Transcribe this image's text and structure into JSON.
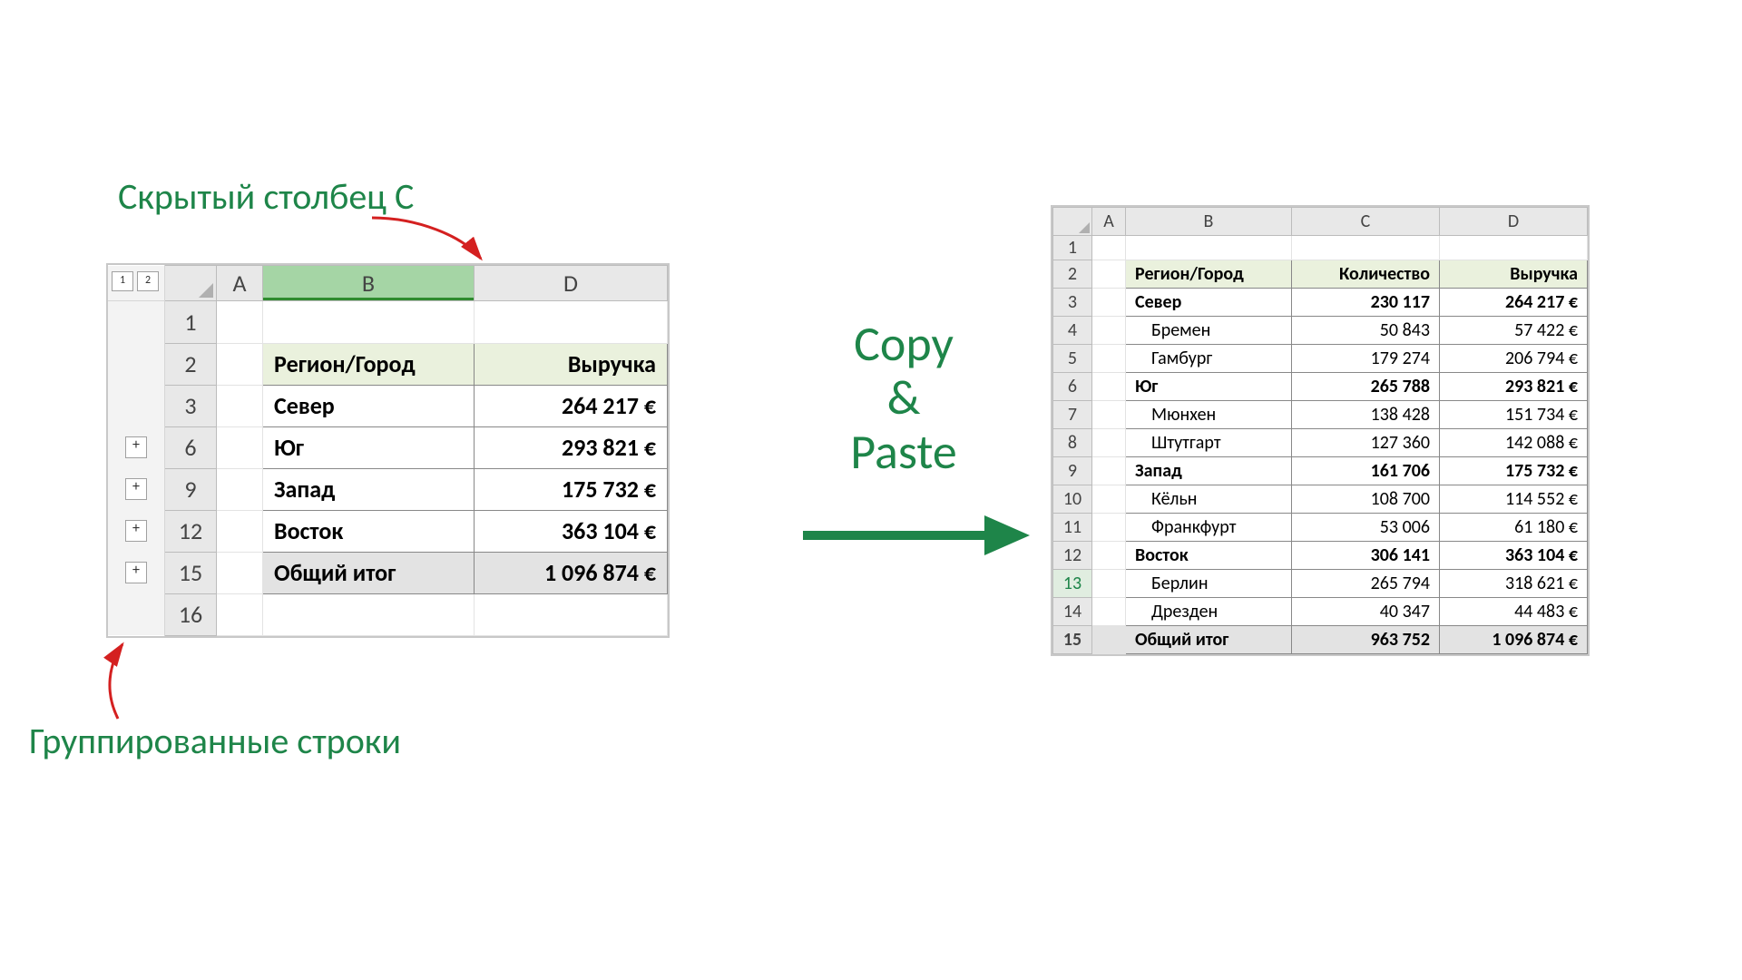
{
  "annotations": {
    "hidden_column": "Скрытый столбец C",
    "grouped_rows": "Группированные строки",
    "copy_paste_line1": "Copy",
    "copy_paste_line2": "&",
    "copy_paste_line3": "Paste"
  },
  "source": {
    "outline_levels": [
      "1",
      "2"
    ],
    "col_headers": {
      "A": "A",
      "B": "B",
      "D": "D"
    },
    "rows": [
      {
        "num": "1",
        "plus": false
      },
      {
        "num": "2",
        "plus": false,
        "header": true,
        "b": "Регион/Город",
        "d": "Выручка"
      },
      {
        "num": "3",
        "plus": false,
        "b": "Север",
        "d": "264 217 €",
        "bold": true
      },
      {
        "num": "6",
        "plus": true,
        "b": "Юг",
        "d": "293 821 €",
        "bold": true
      },
      {
        "num": "9",
        "plus": true,
        "b": "Запад",
        "d": "175 732 €",
        "bold": true
      },
      {
        "num": "12",
        "plus": true,
        "b": "Восток",
        "d": "363 104 €",
        "bold": true
      },
      {
        "num": "15",
        "plus": true,
        "total": true,
        "b": "Общий итог",
        "d": "1 096 874 €"
      },
      {
        "num": "16",
        "plus": false
      }
    ]
  },
  "dest": {
    "col_headers": {
      "A": "A",
      "B": "B",
      "C": "C",
      "D": "D"
    },
    "header": {
      "b": "Регион/Город",
      "c": "Количество",
      "d": "Выручка"
    },
    "rows": [
      {
        "n": "1"
      },
      {
        "n": "2",
        "header": true
      },
      {
        "n": "3",
        "b": "Север",
        "c": "230 117",
        "d": "264 217 €",
        "bold": true
      },
      {
        "n": "4",
        "b": "Бремен",
        "c": "50 843",
        "d": "57 422 €",
        "indent": true
      },
      {
        "n": "5",
        "b": "Гамбург",
        "c": "179 274",
        "d": "206 794 €",
        "indent": true
      },
      {
        "n": "6",
        "b": "Юг",
        "c": "265 788",
        "d": "293 821 €",
        "bold": true
      },
      {
        "n": "7",
        "b": "Мюнхен",
        "c": "138 428",
        "d": "151 734 €",
        "indent": true
      },
      {
        "n": "8",
        "b": "Штутгарт",
        "c": "127 360",
        "d": "142 088 €",
        "indent": true
      },
      {
        "n": "9",
        "b": "Запад",
        "c": "161 706",
        "d": "175 732 €",
        "bold": true
      },
      {
        "n": "10",
        "b": "Кёльн",
        "c": "108 700",
        "d": "114 552 €",
        "indent": true
      },
      {
        "n": "11",
        "b": "Франкфурт",
        "c": "53 006",
        "d": "61 180 €",
        "indent": true
      },
      {
        "n": "12",
        "b": "Восток",
        "c": "306 141",
        "d": "363 104 €",
        "bold": true
      },
      {
        "n": "13",
        "b": "Берлин",
        "c": "265 794",
        "d": "318 621 €",
        "indent": true,
        "sel": true
      },
      {
        "n": "14",
        "b": "Дрезден",
        "c": "40 347",
        "d": "44 483 €",
        "indent": true
      },
      {
        "n": "15",
        "b": "Общий итог",
        "c": "963 752",
        "d": "1 096 874 €",
        "total": true
      }
    ]
  }
}
